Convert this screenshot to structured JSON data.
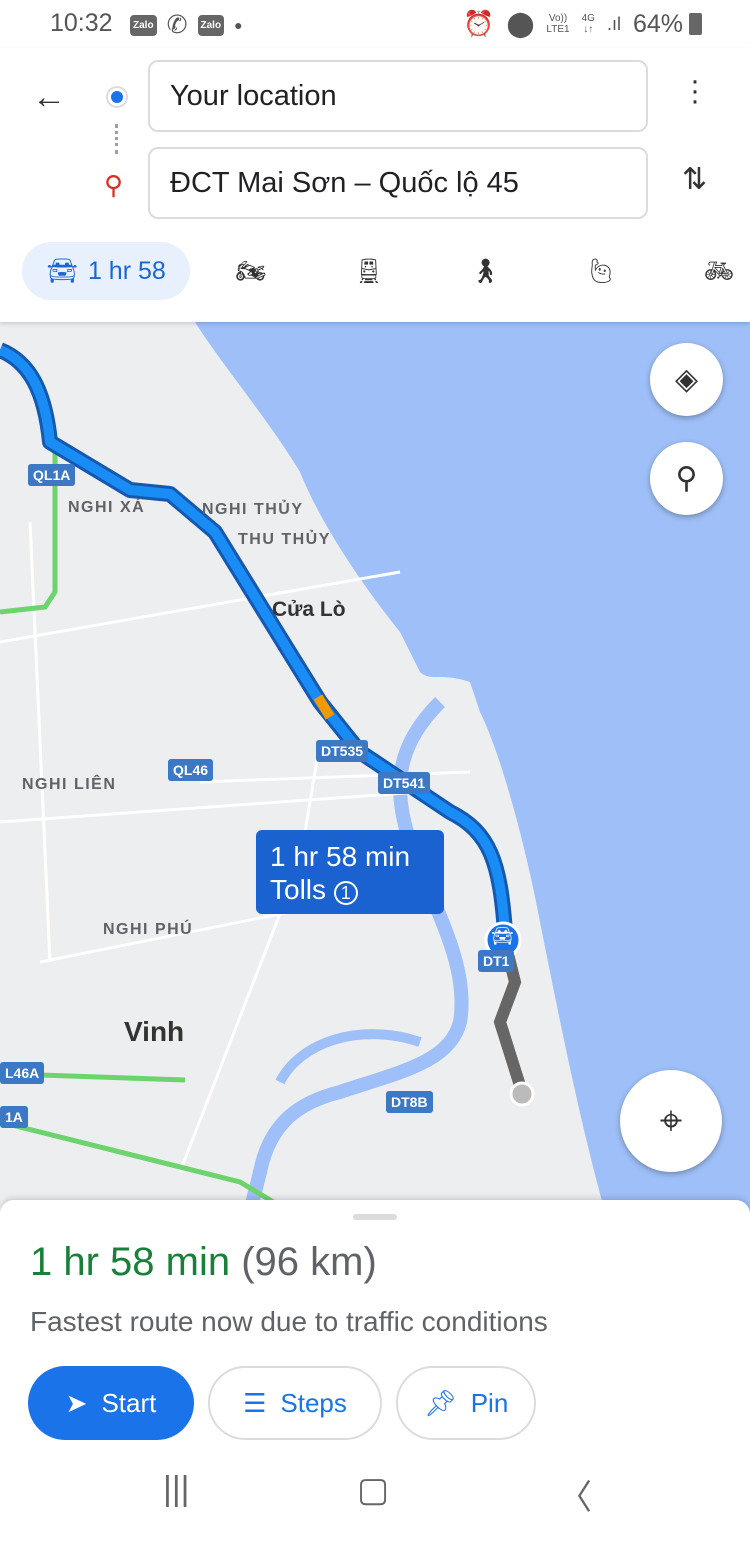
{
  "status_bar": {
    "time": "10:32",
    "apps": [
      "Zalo",
      "viber",
      "Zalo"
    ],
    "network_top": "Vo))",
    "network_bottom": "LTE1",
    "data": "4G",
    "battery": "64%"
  },
  "header": {
    "origin": "Your location",
    "destination": "ĐCT Mai Sơn – Quốc lộ 45",
    "modes": [
      {
        "icon": "car-icon",
        "label": "1 hr 58",
        "active": true
      },
      {
        "icon": "motorcycle-icon"
      },
      {
        "icon": "transit-icon"
      },
      {
        "icon": "walk-icon"
      },
      {
        "icon": "ride-hailing-icon"
      },
      {
        "icon": "bicycle-icon"
      }
    ]
  },
  "map": {
    "labels": {
      "nghi_xa": "NGHI XÁ",
      "nghi_thuy": "NGHI THỦY",
      "thu_thuy": "THU THỦY",
      "cua_lo": "Cửa Lò",
      "nghi_lien": "NGHI LIÊN",
      "nghi_phu": "NGHI PHÚ",
      "vinh": "Vinh"
    },
    "shields": {
      "ql1a": "QL1A",
      "dt535": "DT535",
      "dt541": "DT541",
      "ql46": "QL46",
      "l46a": "L46A",
      "a1": "1A",
      "dt8b": "DT8B",
      "dt1": "DT1"
    },
    "callout": {
      "duration": "1 hr 58 min",
      "tolls": "Tolls",
      "toll_count": "1"
    },
    "colors": {
      "route": "#1a73e8",
      "sea": "#9ebff7",
      "land": "#eceef0",
      "traffic_green": "#6dd36d"
    }
  },
  "sheet": {
    "duration": "1 hr 58 min",
    "distance": "(96 km)",
    "description": "Fastest route now due to traffic conditions",
    "start": "Start",
    "steps": "Steps",
    "pin": "Pin"
  }
}
